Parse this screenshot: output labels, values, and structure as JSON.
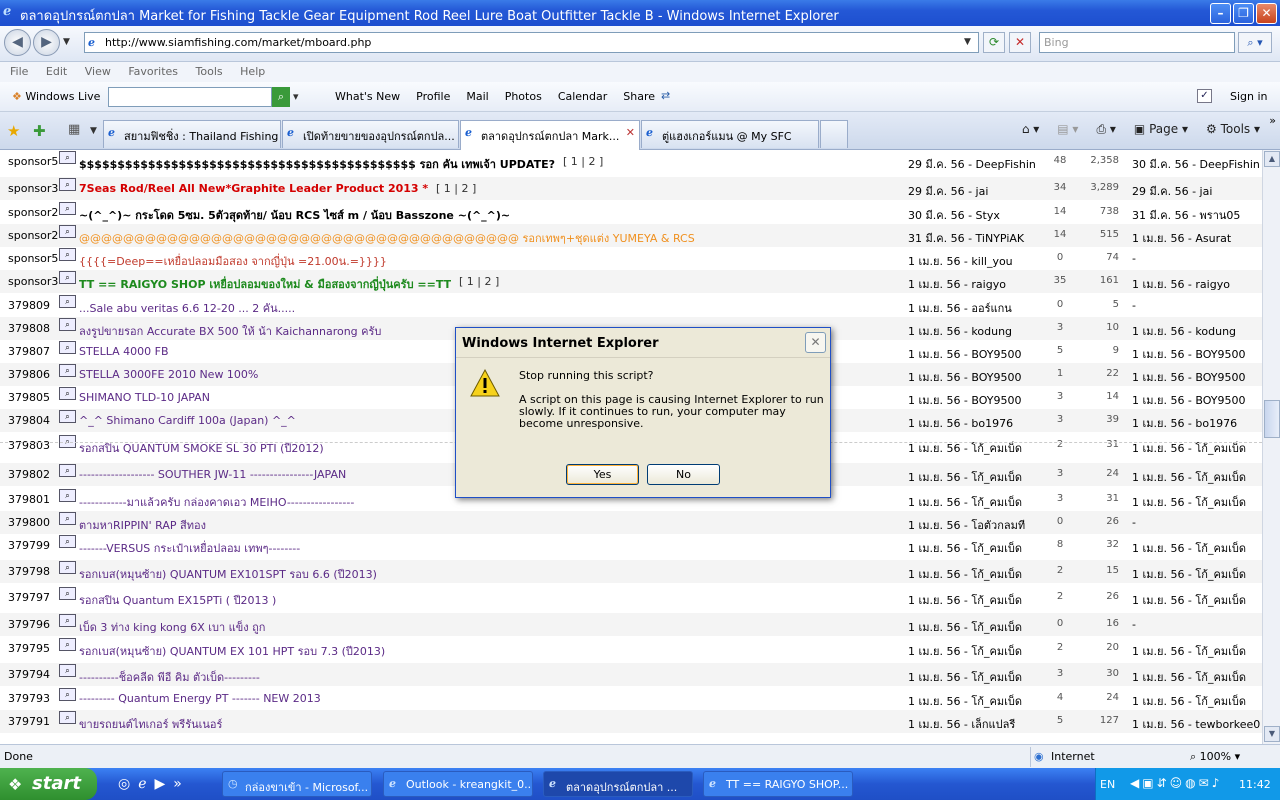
{
  "window": {
    "title": "ตลาดอุปกรณ์ตกปลา Market for Fishing Tackle Gear Equipment Rod Reel Lure Boat Outfitter Tackle B - Windows Internet Explorer"
  },
  "address": {
    "url": "http://www.siamfishing.com/market/mboard.php",
    "search_placeholder": "Bing"
  },
  "menu": [
    "File",
    "Edit",
    "View",
    "Favorites",
    "Tools",
    "Help"
  ],
  "windows_live": {
    "label": "Windows Live",
    "links": [
      "What's New",
      "Profile",
      "Mail",
      "Photos",
      "Calendar",
      "Share"
    ],
    "sign_in": "Sign in"
  },
  "tabs": [
    {
      "label": "สยามฟิชชิ่ง : Thailand Fishing ..."
    },
    {
      "label": "เปิดท้ายขายของอุปกรณ์ตกปล..."
    },
    {
      "label": "ตลาดอุปกรณ์ตกปลา Mark..."
    },
    {
      "label": "ตู่แฮงเกอร์แมน @ My SFC"
    }
  ],
  "tab_tools": {
    "page": "Page",
    "tools": "Tools"
  },
  "rows": [
    {
      "id": "sponsor5",
      "title": "$$$$$$$$$$$$$$$$$$$$$$$$$$$$$$$$$$$$$$$$$$$$ รอก คัน เทพเจ้า UPDATE?",
      "pages": "[ 1 | 2 ]",
      "poster": "29 มี.ค. 56 - DeepFishin",
      "views": "48",
      "replies": "2,358",
      "last": "30 มี.ค. 56 - DeepFishin",
      "color": "#000000",
      "bold": true
    },
    {
      "id": "sponsor3",
      "title": "7Seas Rod/Reel All New*Graphite Leader Product 2013 *",
      "pages": "[ 1 | 2 ]",
      "poster": "29 มี.ค. 56 - jai",
      "views": "34",
      "replies": "3,289",
      "last": "29 มี.ค. 56 - jai",
      "color": "#d40000",
      "bold": true
    },
    {
      "id": "sponsor2",
      "title": "~(^_^)~ กระโดด 5ซม. 5ตัวสุดท้าย/ น้อบ RCS ไซส์ m / น้อบ Basszone ~(^_^)~",
      "pages": "",
      "poster": "30 มี.ค. 56 - Styx",
      "views": "14",
      "replies": "738",
      "last": "31 มี.ค. 56 - พราน05",
      "color": "#000000",
      "bold": true
    },
    {
      "id": "sponsor2",
      "title": "@@@@@@@@@@@@@@@@@@@@@@@@@@@@@@@@@@@@@@@@ รอกเทพๆ+ชุดแต่ง YUMEYA & RCS",
      "pages": "",
      "poster": "31 มี.ค. 56 - TiNYPiAK",
      "views": "14",
      "replies": "515",
      "last": "1 เม.ย. 56 - Asurat",
      "color": "#f0901e",
      "bold": false
    },
    {
      "id": "sponsor5",
      "title": "{{{{=Deep==เหยื่อปลอมมือสอง จากญี่ปุ่น =21.00น.=}}}}",
      "pages": "",
      "poster": "1 เม.ย. 56 - kill_you",
      "views": "0",
      "replies": "74",
      "last": "-",
      "color": "#c0392b",
      "bold": false
    },
    {
      "id": "sponsor3",
      "title": "TT == RAIGYO SHOP เหยื่อปลอมของใหม่ & มือสองจากญี่ปุ่นครับ ==TT",
      "pages": "[ 1 | 2 ]",
      "poster": "1 เม.ย. 56 - raigyo",
      "views": "35",
      "replies": "161",
      "last": "1 เม.ย. 56 - raigyo",
      "color": "#1d8a1d",
      "bold": true
    },
    {
      "id": "379809",
      "title": "...Sale abu veritas 6.6 12-20 ... 2 คัน.....",
      "pages": "",
      "poster": "1 เม.ย. 56 - ออร์แกน",
      "views": "0",
      "replies": "5",
      "last": "-",
      "color": "#5b2a86",
      "bold": false
    },
    {
      "id": "379808",
      "title": "ลงรูปขายรอก Accurate BX 500 ให้ น้า Kaichannarong ครับ",
      "pages": "",
      "poster": "1 เม.ย. 56 - kodung",
      "views": "3",
      "replies": "10",
      "last": "1 เม.ย. 56 - kodung",
      "color": "#5b2a86",
      "bold": false
    },
    {
      "id": "379807",
      "title": "STELLA 4000 FB",
      "pages": "",
      "poster": "1 เม.ย. 56 - BOY9500",
      "views": "5",
      "replies": "9",
      "last": "1 เม.ย. 56 - BOY9500",
      "color": "#5b2a86",
      "bold": false
    },
    {
      "id": "379806",
      "title": "STELLA 3000FE 2010 New 100%",
      "pages": "",
      "poster": "1 เม.ย. 56 - BOY9500",
      "views": "1",
      "replies": "22",
      "last": "1 เม.ย. 56 - BOY9500",
      "color": "#5b2a86",
      "bold": false
    },
    {
      "id": "379805",
      "title": "SHIMANO TLD-10 JAPAN",
      "pages": "",
      "poster": "1 เม.ย. 56 - BOY9500",
      "views": "3",
      "replies": "14",
      "last": "1 เม.ย. 56 - BOY9500",
      "color": "#5b2a86",
      "bold": false
    },
    {
      "id": "379804",
      "title": "^_^ Shimano Cardiff 100a (Japan) ^_^",
      "pages": "",
      "poster": "1 เม.ย. 56 - bo1976",
      "views": "3",
      "replies": "39",
      "last": "1 เม.ย. 56 - bo1976",
      "color": "#5b2a86",
      "bold": false
    },
    {
      "id": "379803",
      "title": "รอกสปิน QUANTUM SMOKE SL 30 PTI (ปี2012)",
      "pages": "",
      "poster": "1 เม.ย. 56 - โก้_คมเบ็ด",
      "views": "2",
      "replies": "31",
      "last": "1 เม.ย. 56 - โก้_คมเบ็ด",
      "color": "#5b2a86",
      "bold": false
    },
    {
      "id": "379802",
      "title": "------------------- SOUTHER JW-11 ----------------JAPAN",
      "pages": "",
      "poster": "1 เม.ย. 56 - โก้_คมเบ็ด",
      "views": "3",
      "replies": "24",
      "last": "1 เม.ย. 56 - โก้_คมเบ็ด",
      "color": "#5b2a86",
      "bold": false
    },
    {
      "id": "379801",
      "title": "------------มาแล้วครับ กล่องคาดเอว MEIHO-----------------",
      "pages": "",
      "poster": "1 เม.ย. 56 - โก้_คมเบ็ด",
      "views": "3",
      "replies": "31",
      "last": "1 เม.ย. 56 - โก้_คมเบ็ด",
      "color": "#5b2a86",
      "bold": false
    },
    {
      "id": "379800",
      "title": "ตามหาRIPPIN' RAP สีทอง",
      "pages": "",
      "poster": "1 เม.ย. 56 - โอตัวกลมที",
      "views": "0",
      "replies": "26",
      "last": "-",
      "color": "#5b2a86",
      "bold": false
    },
    {
      "id": "379799",
      "title": "-------VERSUS กระเป๋าเหยื่อปลอม เทพๆ--------",
      "pages": "",
      "poster": "1 เม.ย. 56 - โก้_คมเบ็ด",
      "views": "8",
      "replies": "32",
      "last": "1 เม.ย. 56 - โก้_คมเบ็ด",
      "color": "#5b2a86",
      "bold": false
    },
    {
      "id": "379798",
      "title": "รอกเบส(หมุนซ้าย) QUANTUM EX101SPT รอบ 6.6 (ปี2013)",
      "pages": "",
      "poster": "1 เม.ย. 56 - โก้_คมเบ็ด",
      "views": "2",
      "replies": "15",
      "last": "1 เม.ย. 56 - โก้_คมเบ็ด",
      "color": "#5b2a86",
      "bold": false
    },
    {
      "id": "379797",
      "title": "รอกสปิน Quantum EX15PTi ( ปี2013 )",
      "pages": "",
      "poster": "1 เม.ย. 56 - โก้_คมเบ็ด",
      "views": "2",
      "replies": "26",
      "last": "1 เม.ย. 56 - โก้_คมเบ็ด",
      "color": "#5b2a86",
      "bold": false
    },
    {
      "id": "379796",
      "title": "เบ็ด 3 ท่าง king kong 6X เบา แข็ง ถูก",
      "pages": "",
      "poster": "1 เม.ย. 56 - โก้_คมเบ็ด",
      "views": "0",
      "replies": "16",
      "last": "-",
      "color": "#5b2a86",
      "bold": false
    },
    {
      "id": "379795",
      "title": "รอกเบส(หมุนซ้าย) QUANTUM EX 101 HPT รอบ 7.3 (ปี2013)",
      "pages": "",
      "poster": "1 เม.ย. 56 - โก้_คมเบ็ด",
      "views": "2",
      "replies": "20",
      "last": "1 เม.ย. 56 - โก้_คมเบ็ด",
      "color": "#5b2a86",
      "bold": false
    },
    {
      "id": "379794",
      "title": "----------ช็อคลีด พีอี คิม ตัวเบ็ด---------",
      "pages": "",
      "poster": "1 เม.ย. 56 - โก้_คมเบ็ด",
      "views": "3",
      "replies": "30",
      "last": "1 เม.ย. 56 - โก้_คมเบ็ด",
      "color": "#5b2a86",
      "bold": false
    },
    {
      "id": "379793",
      "title": "--------- Quantum Energy PT ------- NEW 2013",
      "pages": "",
      "poster": "1 เม.ย. 56 - โก้_คมเบ็ด",
      "views": "4",
      "replies": "24",
      "last": "1 เม.ย. 56 - โก้_คมเบ็ด",
      "color": "#5b2a86",
      "bold": false
    },
    {
      "id": "379791",
      "title": "ขายรถยนต์ไทเกอร์ พรีรันเนอร์",
      "pages": "",
      "poster": "1 เม.ย. 56 - เล็กแปลรี",
      "views": "5",
      "replies": "127",
      "last": "1 เม.ย. 56 - tewborkee0",
      "color": "#5b2a86",
      "bold": false
    }
  ],
  "status": {
    "left": "Done",
    "zone": "Internet",
    "zoom": "100%"
  },
  "taskbar": {
    "start": "start",
    "tasks": [
      "กล่องขาเข้า - Microsof...",
      "Outlook - kreangkit_0...",
      "ตลาดอุปกรณ์ตกปลา ...",
      "TT == RAIGYO SHOP..."
    ],
    "lang": "EN",
    "time": "11:42"
  },
  "dialog": {
    "title": "Windows Internet Explorer",
    "question": "Stop running this script?",
    "message": "A script on this page is causing Internet Explorer to run slowly. If it continues to run, your computer may become unresponsive.",
    "yes": "Yes",
    "no": "No"
  }
}
